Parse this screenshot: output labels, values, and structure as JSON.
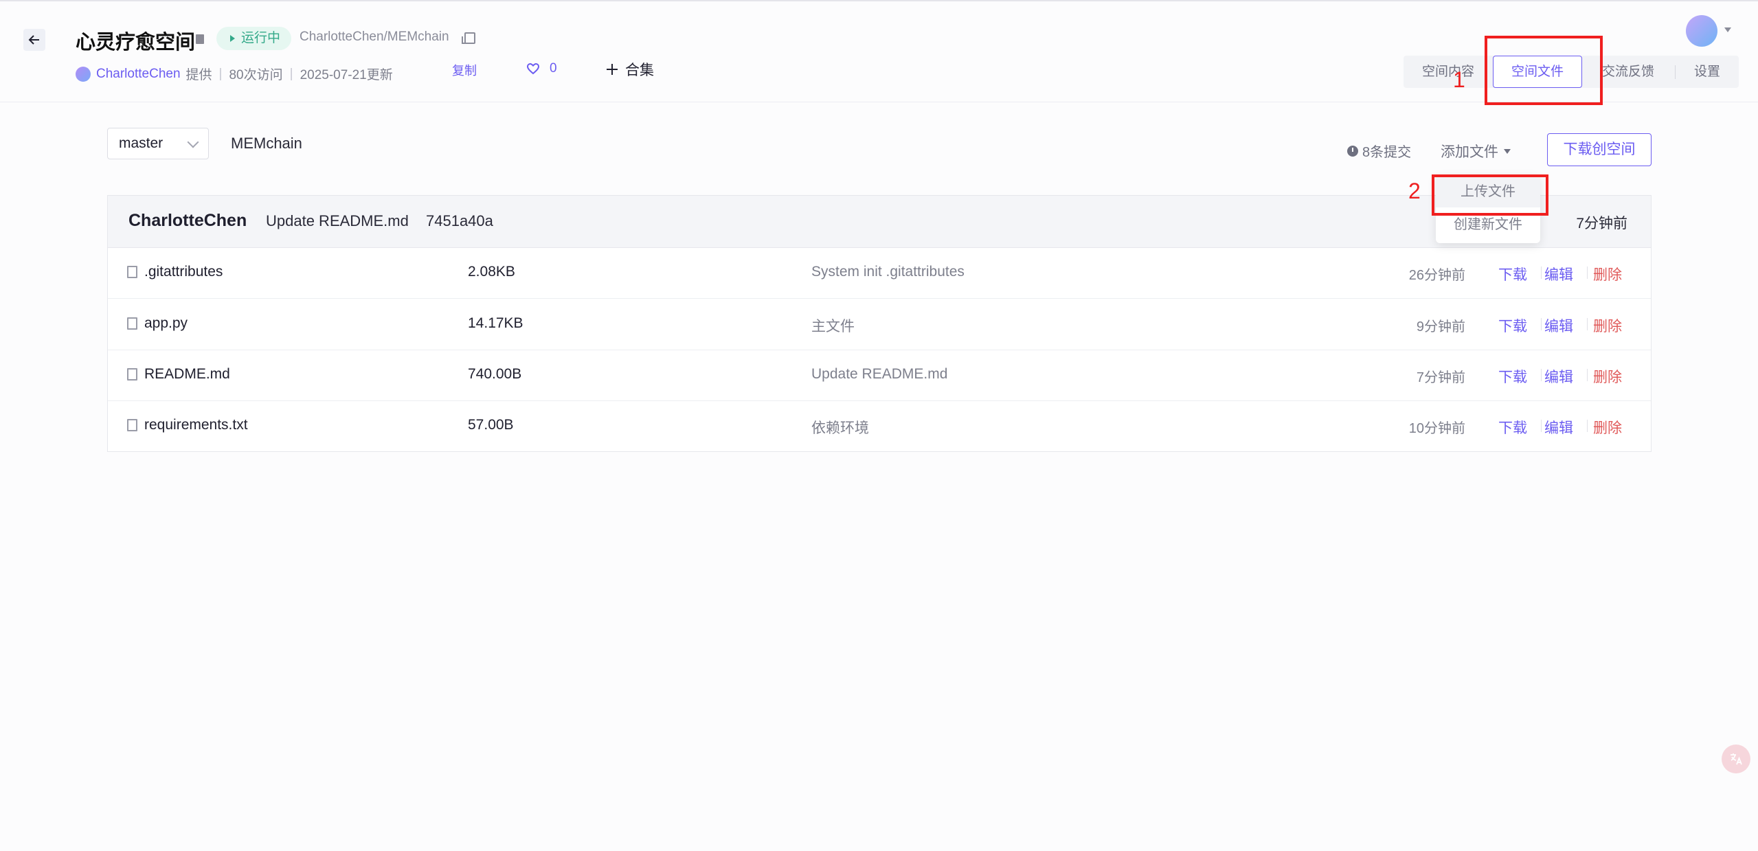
{
  "header": {
    "title": "心灵疗愈空间",
    "status": "运行中",
    "repo_path": "CharlotteChen/MEMchain",
    "author": "CharlotteChen",
    "provided": "提供",
    "visits": "80次访问",
    "updated": "2025-07-21更新",
    "copy_label": "复制",
    "likes": "0",
    "collect_label": "合集"
  },
  "tabs": [
    {
      "label": "空间内容",
      "active": false
    },
    {
      "label": "空间文件",
      "active": true
    },
    {
      "label": "交流反馈",
      "active": false
    },
    {
      "label": "设置",
      "active": false
    }
  ],
  "annotations": {
    "one": "1",
    "two": "2"
  },
  "toolbar": {
    "branch": "master",
    "repo_name": "MEMchain",
    "commits": "8条提交",
    "add_file": "添加文件",
    "download_space": "下载创空间"
  },
  "dropdown": {
    "items": [
      "上传文件",
      "创建新文件"
    ]
  },
  "commit_header": {
    "author": "CharlotteChen",
    "message": "Update README.md",
    "hash": "7451a40a",
    "time": "7分钟前"
  },
  "files": [
    {
      "name": ".gitattributes",
      "size": "2.08KB",
      "message": "System init .gitattributes",
      "time": "26分钟前"
    },
    {
      "name": "app.py",
      "size": "14.17KB",
      "message": "主文件",
      "time": "9分钟前"
    },
    {
      "name": "README.md",
      "size": "740.00B",
      "message": "Update README.md",
      "time": "7分钟前"
    },
    {
      "name": "requirements.txt",
      "size": "57.00B",
      "message": "依赖环境",
      "time": "10分钟前"
    }
  ],
  "actions": {
    "download": "下载",
    "edit": "编辑",
    "delete": "删除"
  },
  "colors": {
    "accent": "#6b5cf1",
    "danger": "#e05a5a",
    "status": "#33a989",
    "annotation": "#f01f1f"
  }
}
